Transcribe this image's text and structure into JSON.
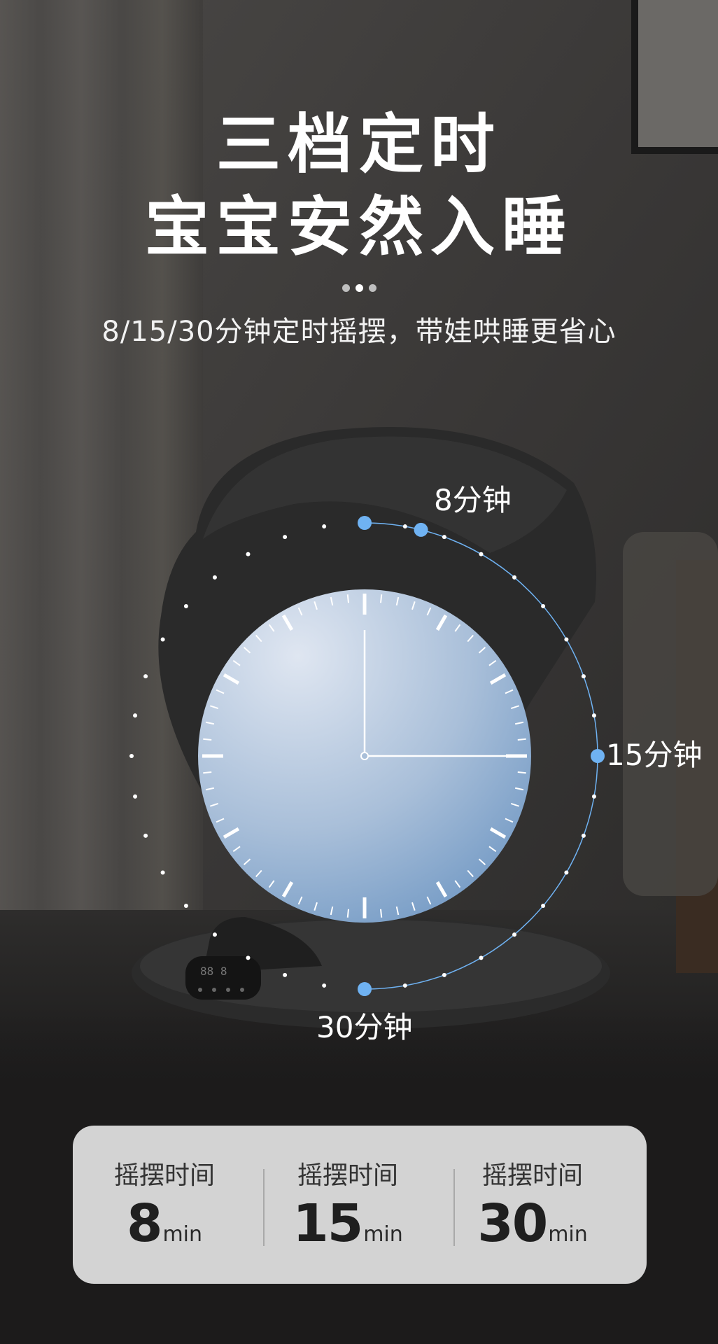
{
  "header": {
    "title_line1": "三档定时",
    "title_line2": "宝宝安然入睡",
    "subtitle": "8/15/30分钟定时摇摆，带娃哄睡更省心"
  },
  "dial": {
    "label_8": "8分钟",
    "label_15": "15分钟",
    "label_30": "30分钟",
    "accent_color": "#6fb2f2"
  },
  "panel": {
    "items": [
      {
        "label": "摇摆时间",
        "value": "8",
        "unit": "min"
      },
      {
        "label": "摇摆时间",
        "value": "15",
        "unit": "min"
      },
      {
        "label": "摇摆时间",
        "value": "30",
        "unit": "min"
      }
    ]
  }
}
